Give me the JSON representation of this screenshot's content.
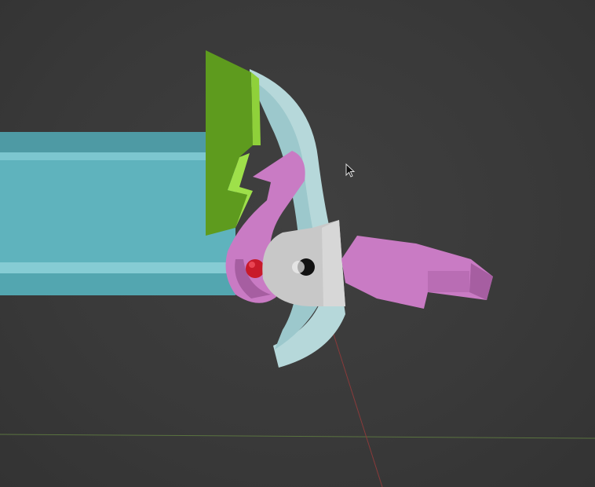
{
  "viewport": {
    "type": "3d-viewport",
    "cursor_icon": "arrow-cursor-icon"
  },
  "colors": {
    "background": "#3a3a3a",
    "channel": "#5fb3bd",
    "channel_dark": "#3f8f99",
    "green_plate": "#5e9b1e",
    "green_light": "#8fd13a",
    "purple": "#c97bc4",
    "purple_dark": "#a65ea1",
    "gray_part": "#c8c8c8",
    "pale_blade": "#b9dcdf",
    "red_ball": "#c81a2a",
    "x_axis": "#7a3a3a",
    "y_axis": "#5a7a3a"
  }
}
